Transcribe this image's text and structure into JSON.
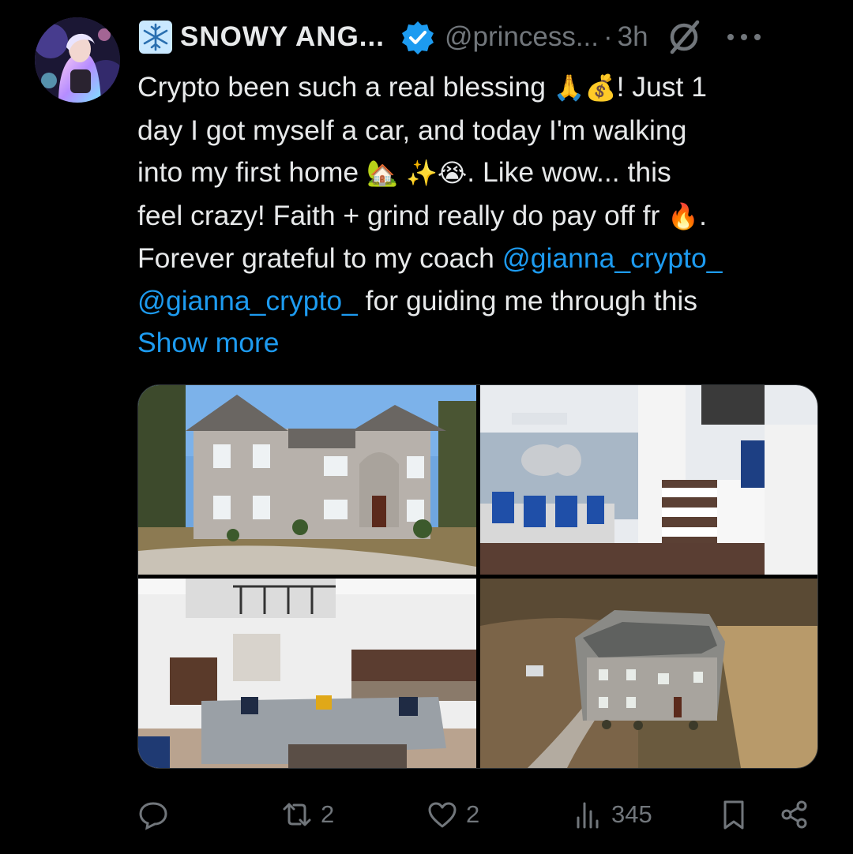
{
  "post": {
    "author": {
      "display_name": "SNOWY ANG...",
      "handle": "@princess...",
      "separator": "·",
      "time": "3h"
    },
    "text": {
      "line1_a": "Crypto been such a real blessing ",
      "line1_emoji1": "🙏",
      "line1_emoji2": "💰",
      "line1_b": "! Just 1",
      "line2": "day I got myself a car, and today I'm walking",
      "line3_a": "into my first home ",
      "line3_emoji1": "🏡",
      "line3_emoji2": " ✨",
      "line3_emoji3": "😭",
      "line3_b": ". Like wow... this",
      "line4_a": "feel crazy! Faith + grind really do pay off fr ",
      "line4_emoji": "🔥",
      "line4_b": ".",
      "line5_a": "Forever grateful to my coach ",
      "line5_mention": "@gianna_crypto_",
      "line6_mention": "@gianna_crypto_",
      "line6_b": " for guiding me through this",
      "show_more": "Show more"
    },
    "media": [
      {
        "icon": "house-exterior-photo"
      },
      {
        "icon": "dining-room-photo"
      },
      {
        "icon": "living-room-photo"
      },
      {
        "icon": "aerial-house-photo"
      }
    ],
    "actions": {
      "reply_count": "",
      "repost_count": "2",
      "like_count": "2",
      "views_count": "345"
    }
  },
  "colors": {
    "background": "#000000",
    "text": "#e7e9ea",
    "muted": "#71767b",
    "accent": "#1d9bf0",
    "border": "#2f3336"
  }
}
